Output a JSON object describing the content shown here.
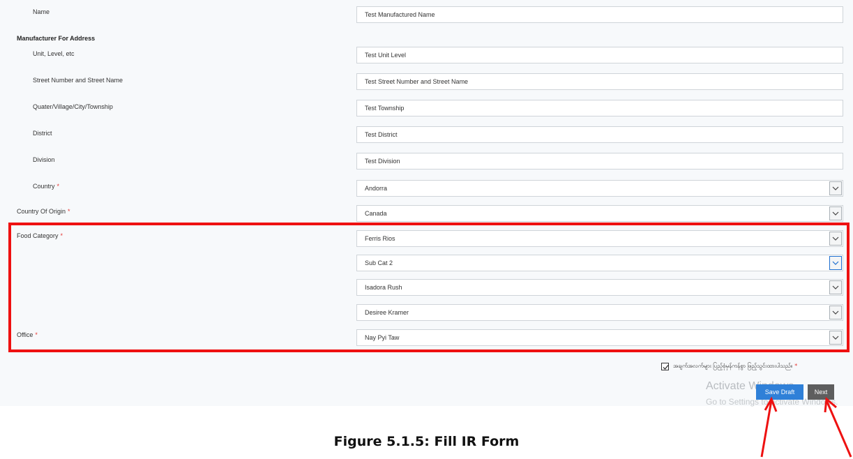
{
  "form": {
    "name_label": "Name",
    "name_value": "Test Manufactured Name",
    "address_heading": "Manufacturer For Address",
    "unit_label": "Unit, Level, etc",
    "unit_value": "Test Unit Level",
    "street_label": "Street Number and Street Name",
    "street_value": "Test Street Number and Street Name",
    "township_label": "Quater/Village/City/Township",
    "township_value": "Test Township",
    "district_label": "District",
    "district_value": "Test District",
    "division_label": "Division",
    "division_value": "Test Division",
    "country_label": "Country",
    "country_value": "Andorra",
    "origin_label": "Country Of Origin",
    "origin_value": "Canada",
    "food_category_label": "Food Category",
    "food_category_1": "Ferris Rios",
    "food_category_2": "Sub Cat 2",
    "food_category_3": "Isadora Rush",
    "food_category_4": "Desiree Kramer",
    "office_label": "Office",
    "office_value": "Nay Pyi Taw",
    "required_mark": "*",
    "confirm_text": "အချက်အလက်များ ပြည့်စုံမှန်ကန်စွာ ဖြည့်သွင်းထားပါသည်။",
    "save_draft_label": "Save Draft",
    "next_label": "Next"
  },
  "watermark": {
    "line1": "Activate Windows",
    "line2": "Go to Settings to activate Windows."
  },
  "caption": "Figure 5.1.5: Fill IR Form",
  "colors": {
    "highlight": "#ee1111",
    "required": "#e53935",
    "save_button": "#2f80d8",
    "next_button": "#5e5e5e"
  }
}
